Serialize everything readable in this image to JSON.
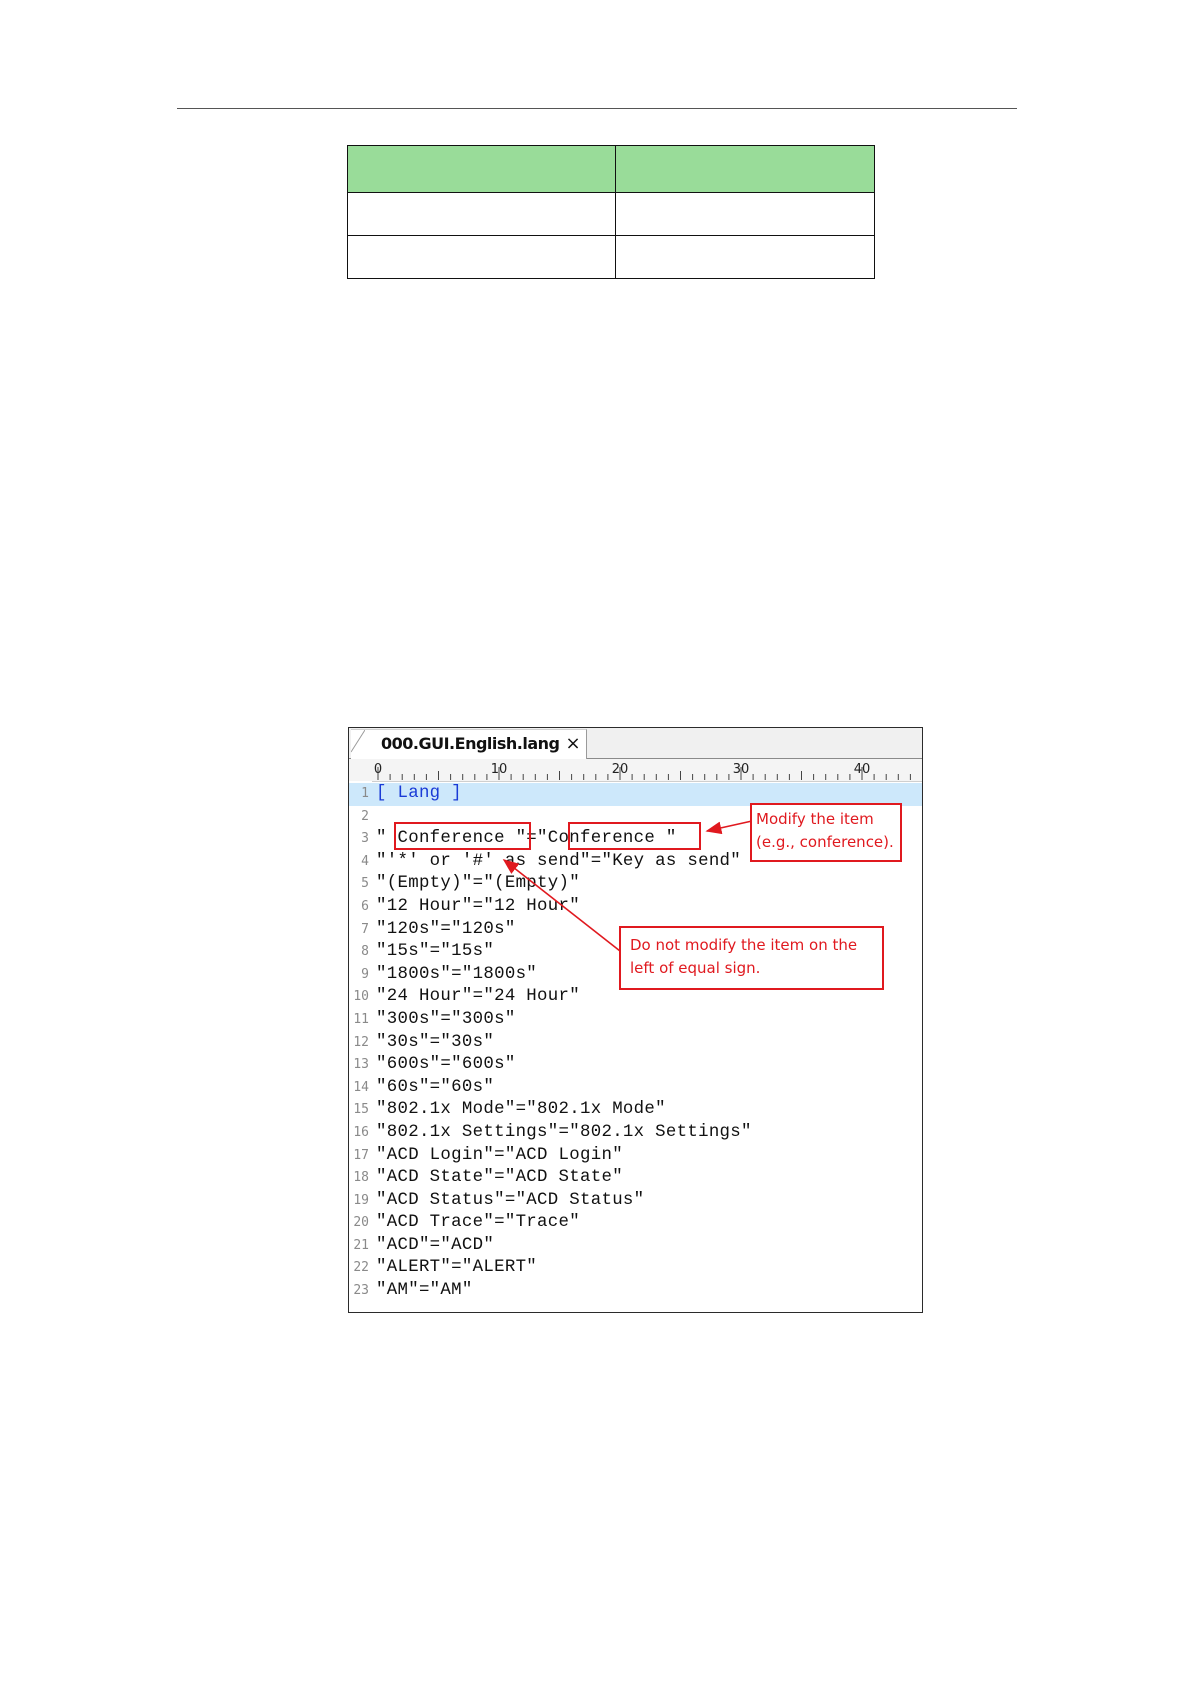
{
  "table": {
    "header": [
      "",
      ""
    ],
    "rows": [
      [
        "",
        ""
      ],
      [
        "",
        ""
      ]
    ]
  },
  "editor": {
    "tab_title": "000.GUI.English.lang",
    "close_glyph": "×",
    "ruler_labels": [
      "0",
      "10",
      "20",
      "30",
      "40"
    ],
    "lines": [
      {
        "n": "1",
        "text": "[ Lang ]"
      },
      {
        "n": "2",
        "text": ""
      },
      {
        "n": "3",
        "text": "\" Conference \"=\"Conference \""
      },
      {
        "n": "4",
        "text": "\"'*' or '#' as send\"=\"Key as send\""
      },
      {
        "n": "5",
        "text": "\"(Empty)\"=\"(Empty)\""
      },
      {
        "n": "6",
        "text": "\"12 Hour\"=\"12 Hour\""
      },
      {
        "n": "7",
        "text": "\"120s\"=\"120s\""
      },
      {
        "n": "8",
        "text": "\"15s\"=\"15s\""
      },
      {
        "n": "9",
        "text": "\"1800s\"=\"1800s\""
      },
      {
        "n": "10",
        "text": "\"24 Hour\"=\"24 Hour\""
      },
      {
        "n": "11",
        "text": "\"300s\"=\"300s\""
      },
      {
        "n": "12",
        "text": "\"30s\"=\"30s\""
      },
      {
        "n": "13",
        "text": "\"600s\"=\"600s\""
      },
      {
        "n": "14",
        "text": "\"60s\"=\"60s\""
      },
      {
        "n": "15",
        "text": "\"802.1x Mode\"=\"802.1x Mode\""
      },
      {
        "n": "16",
        "text": "\"802.1x Settings\"=\"802.1x Settings\""
      },
      {
        "n": "17",
        "text": "\"ACD Login\"=\"ACD Login\""
      },
      {
        "n": "18",
        "text": "\"ACD State\"=\"ACD State\""
      },
      {
        "n": "19",
        "text": "\"ACD Status\"=\"ACD Status\""
      },
      {
        "n": "20",
        "text": "\"ACD Trace\"=\"Trace\""
      },
      {
        "n": "21",
        "text": "\"ACD\"=\"ACD\""
      },
      {
        "n": "22",
        "text": "\"ALERT\"=\"ALERT\""
      },
      {
        "n": "23",
        "text": "\"AM\"=\"AM\""
      }
    ],
    "callout_modify": "Modify the item (e.g., conference).",
    "callout_donot": "Do not modify the item on the left of equal sign."
  },
  "colors": {
    "table_header_bg": "#99dc99",
    "annotation_red": "#e0191f",
    "highlight_line": "#cde8fb"
  }
}
